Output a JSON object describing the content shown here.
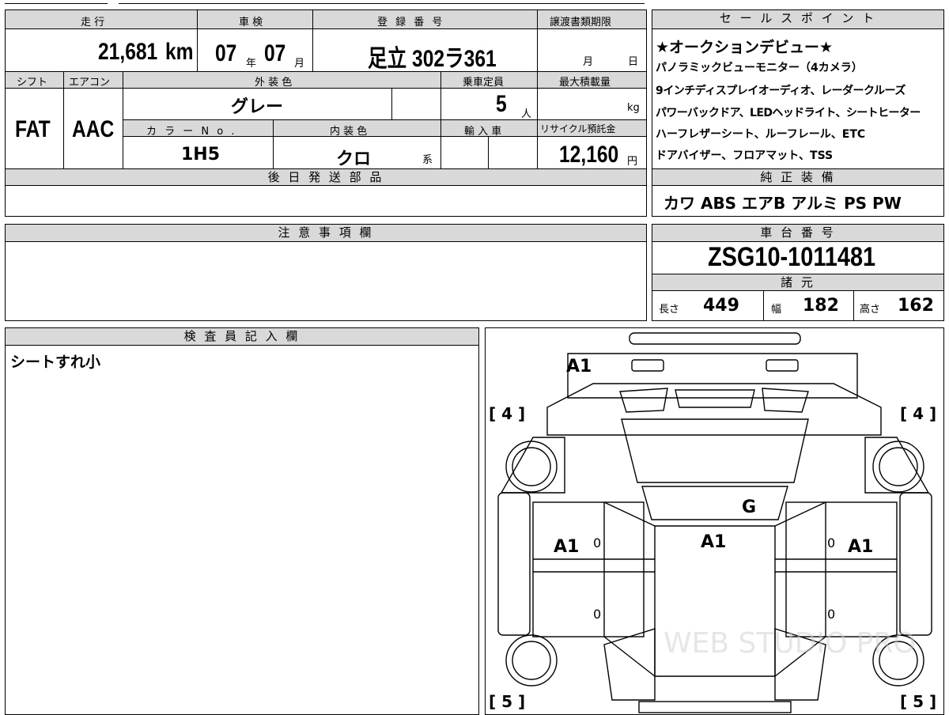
{
  "headers": {
    "mileage": "走 行",
    "inspection": "車 検",
    "registration": "登 録 番 号",
    "transfer_deadline": "譲渡書類期限",
    "shift": "シフト",
    "aircon": "エアコン",
    "exterior_color": "外 装 色",
    "capacity": "乗車定員",
    "max_load": "最大積載量",
    "color_no": "カ ラ ー N o .",
    "interior_color": "内 装 色",
    "import": "輸 入 車",
    "recycle": "リサイクル預託金",
    "later_parts": "後 日 発 送 部 品",
    "notes": "注 意 事 項 欄",
    "inspector": "検 査 員 記 入 欄",
    "sales_points": "セ ー ル ス ポ イ ン ト",
    "genuine_equipment": "純 正 装 備",
    "chassis": "車 台 番 号",
    "specs": "諸 元"
  },
  "vehicle": {
    "mileage_value": "21,681",
    "mileage_unit": "km",
    "inspection_year": "07",
    "year_unit": "年",
    "inspection_month": "07",
    "month_unit": "月",
    "registration_number": "足立 302ラ361",
    "deadline_month": "月",
    "deadline_day": "日",
    "shift": "FAT",
    "aircon": "AAC",
    "exterior_color": "グレー",
    "capacity_value": "5",
    "capacity_unit": "人",
    "load_unit": "kg",
    "color_no": "1H5",
    "interior_color": "クロ",
    "interior_suffix": "系",
    "recycle_value": "12,160",
    "recycle_unit": "円"
  },
  "sales_points": [
    "★オークションデビュー★",
    "パノラミックビューモニター（4カメラ）",
    "9インチディスプレイオーディオ、レーダークルーズ",
    "パワーバックドア、LEDヘッドライト、シートヒーター",
    "ハーフレザーシート、ルーフレール、ETC",
    "ドアバイザー、フロアマット、TSS"
  ],
  "genuine_equipment": "カワ ABS エアB アルミ PS PW",
  "chassis_number": "ZSG10-1011481",
  "specs": {
    "length_label": "長さ",
    "length_value": "449",
    "width_label": "幅",
    "width_value": "182",
    "height_label": "高さ",
    "height_value": "162"
  },
  "inspector_note": "シートすれ小",
  "diagram_marks": {
    "front_left_corner": "A1",
    "windshield": "G",
    "roof": "A1",
    "left_front_door": "A1",
    "right_front_door": "A1",
    "zero": "0",
    "tire_fl": "[ 4 ]",
    "tire_fr": "[ 4 ]",
    "tire_rl": "[ 5 ]",
    "tire_rr": "[ 5 ]"
  },
  "watermark": "WEB STUDIO PRO"
}
